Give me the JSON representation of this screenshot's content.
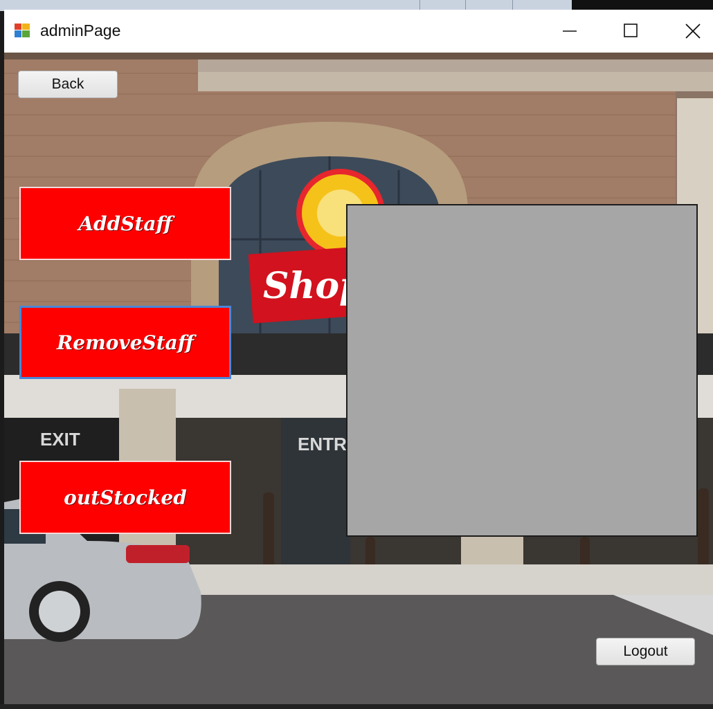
{
  "window": {
    "title": "adminPage"
  },
  "icons": {
    "app": "app-icon",
    "minimize": "minimize-icon",
    "maximize": "maximize-icon",
    "close": "close-icon"
  },
  "buttons": {
    "back": "Back",
    "add_staff": "AddStaff",
    "remove_staff": "RemoveStaff",
    "out_stocked": "outStocked",
    "logout": "Logout"
  },
  "background": {
    "store_sign": "Shop",
    "exit_sign": "EXIT",
    "entrance_sign": "ENTRA"
  },
  "colors": {
    "action_button": "#ff0000",
    "panel": "#a6a6a6",
    "focus_border": "#4a86d6"
  }
}
